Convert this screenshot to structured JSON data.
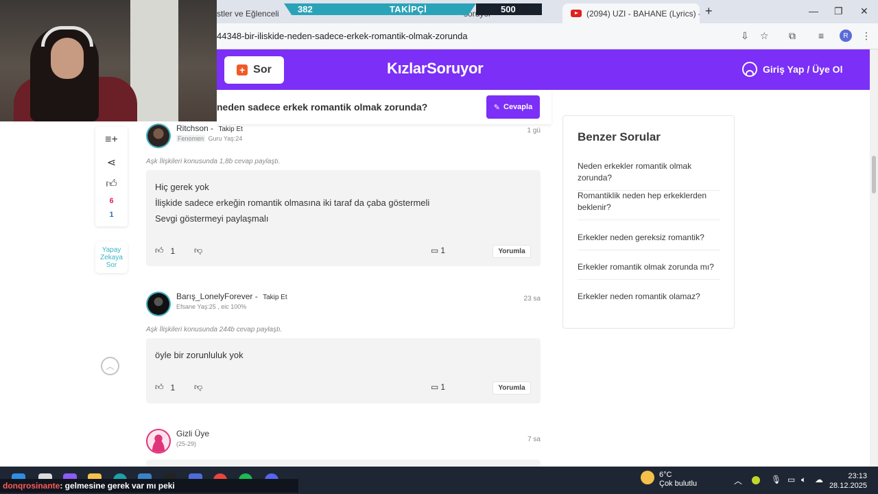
{
  "browser": {
    "tabs": [
      {
        "label": "stler ve Eğlenceli"
      },
      {
        "label": "soruyor"
      },
      {
        "label": "(2094) UZI - BAHANE (Lyrics) -",
        "favicon": "youtube-icon"
      }
    ],
    "url": "44348-bir-iliskide-neden-sadece-erkek-romantik-olmak-zorunda"
  },
  "overlay": {
    "followers_current": "382",
    "followers_label": "TAKİPÇİ",
    "followers_target": "500"
  },
  "site": {
    "ask_label": "Sor",
    "logo": "KızlarSoruyor",
    "login_label": "Giriş Yap / Üye Ol",
    "accent": "#7b2ff7"
  },
  "question": {
    "title": "neden sadece erkek romantik olmak zorunda?",
    "answer_button": "Cevapla"
  },
  "rail": {
    "likes": "6",
    "shares": "1",
    "ai_label": "Yapay Zekaya Sor"
  },
  "answers": [
    {
      "username": "Ritchson",
      "follow_label": "Takip Et",
      "badge": "Fenomen",
      "meta": "Guru Yaş:24",
      "time": "1 gü",
      "shared": "Aşk İlişkileri konusunda 1,8b cevap paylaştı.",
      "lines": [
        "Hiç gerek yok",
        "İlişkide sadece erkeğin romantik olmasına iki taraf da çaba göstermeli",
        "Sevgi göstermeyi paylaşmalı"
      ],
      "likes": "1",
      "comments": "1",
      "comment_button": "Yorumla"
    },
    {
      "username": "Barış_LonelyForever",
      "follow_label": "Takip Et",
      "meta": "Efsane Yaş:25 , eic 100%",
      "time": "23 sa",
      "shared": "Aşk İlişkileri konusunda 244b cevap paylaştı.",
      "lines": [
        "öyle bir zorunluluk yok"
      ],
      "likes": "1",
      "comments": "1",
      "comment_button": "Yorumla"
    },
    {
      "username": "Gizli Üye",
      "meta": "(25-29)",
      "time": "7 sa"
    }
  ],
  "similar": {
    "title": "Benzer Sorular",
    "items": [
      "Neden erkekler romantik olmak zorunda?",
      "Romantiklik neden hep erkeklerden beklenir?",
      "Erkekler neden gereksiz romantik?",
      "Erkekler romantik olmak zorunda mı?",
      "Erkekler neden romantik olamaz?"
    ]
  },
  "taskbar": {
    "chat_nick": "donqrosinante",
    "chat_message": ": gelmesine gerek var mı peki",
    "temperature": "6°C",
    "weather": "Çok bulutlu",
    "time": "23:13",
    "date": "28.12.2025"
  }
}
